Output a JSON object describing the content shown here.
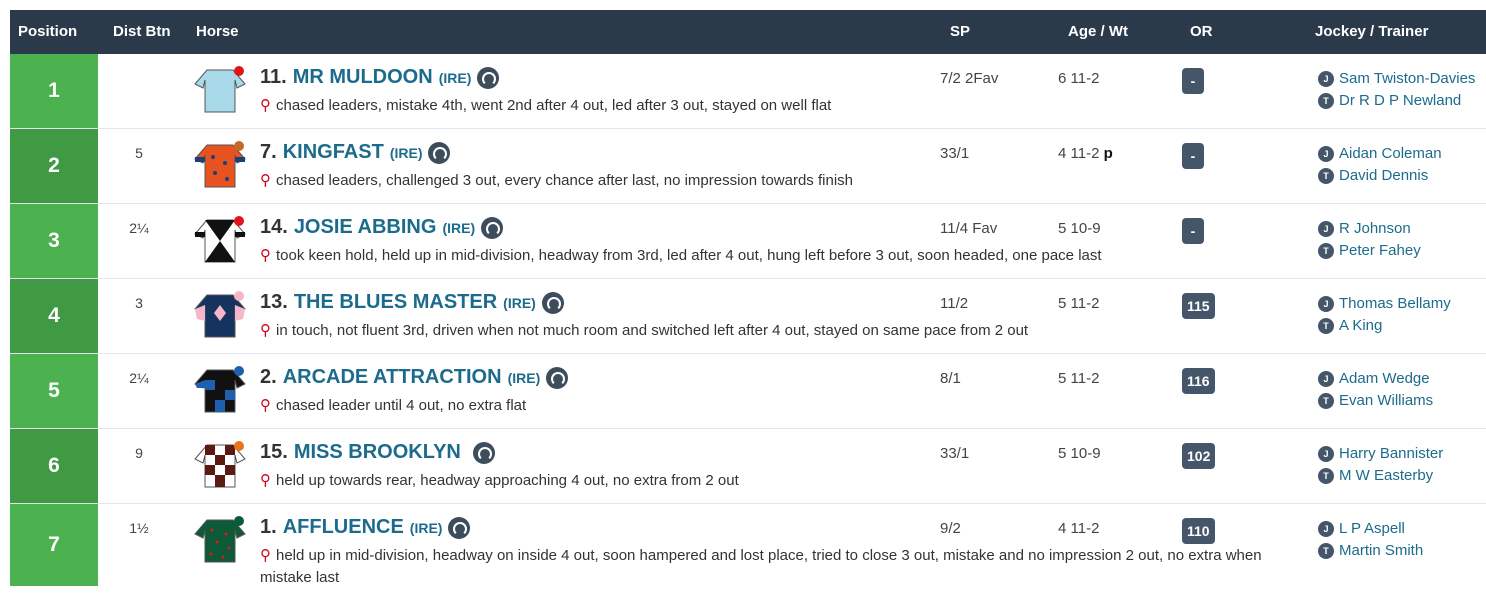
{
  "headers": {
    "position": "Position",
    "dist": "Dist Btn",
    "horse": "Horse",
    "sp": "SP",
    "agewt": "Age / Wt",
    "or": "OR",
    "jockey_trainer": "Jockey / Trainer"
  },
  "rows": [
    {
      "position": "1",
      "dist": "",
      "number": "11.",
      "name": "MR MULDOON",
      "bred": "(IRE)",
      "comment": "chased leaders, mistake 4th, went 2nd after 4 out, led after 3 out, stayed on well flat",
      "sp": "7/2 2Fav",
      "age_wt": "6 11-2",
      "headgear": "",
      "or": "-",
      "jockey": "Sam Twiston-Davies",
      "trainer": "Dr R D P Newland"
    },
    {
      "position": "2",
      "dist": "5",
      "number": "7.",
      "name": "KINGFAST",
      "bred": "(IRE)",
      "comment": "chased leaders, challenged 3 out, every chance after last, no impression towards finish",
      "sp": "33/1",
      "age_wt": "4 11-2",
      "headgear": "p",
      "or": "-",
      "jockey": "Aidan Coleman",
      "trainer": "David Dennis"
    },
    {
      "position": "3",
      "dist": "2¼",
      "number": "14.",
      "name": "JOSIE ABBING",
      "bred": "(IRE)",
      "comment": "took keen hold, held up in mid-division, headway from 3rd, led after 4 out, hung left before 3 out, soon headed, one pace last",
      "sp": "11/4 Fav",
      "age_wt": "5 10-9",
      "headgear": "",
      "or": "-",
      "jockey": "R Johnson",
      "trainer": "Peter Fahey"
    },
    {
      "position": "4",
      "dist": "3",
      "number": "13.",
      "name": "THE BLUES MASTER",
      "bred": "(IRE)",
      "comment": "in touch, not fluent 3rd, driven when not much room and switched left after 4 out, stayed on same pace from 2 out",
      "sp": "11/2",
      "age_wt": "5 11-2",
      "headgear": "",
      "or": "115",
      "jockey": "Thomas Bellamy",
      "trainer": "A King"
    },
    {
      "position": "5",
      "dist": "2¼",
      "number": "2.",
      "name": "ARCADE ATTRACTION",
      "bred": "(IRE)",
      "comment": "chased leader until 4 out, no extra flat",
      "sp": "8/1",
      "age_wt": "5 11-2",
      "headgear": "",
      "or": "116",
      "jockey": "Adam Wedge",
      "trainer": "Evan Williams"
    },
    {
      "position": "6",
      "dist": "9",
      "number": "15.",
      "name": "MISS BROOKLYN",
      "bred": "",
      "comment": "held up towards rear, headway approaching 4 out, no extra from 2 out",
      "sp": "33/1",
      "age_wt": "5 10-9",
      "headgear": "",
      "or": "102",
      "jockey": "Harry Bannister",
      "trainer": "M W Easterby"
    },
    {
      "position": "7",
      "dist": "1½",
      "number": "1.",
      "name": "AFFLUENCE",
      "bred": "(IRE)",
      "comment": "held up in mid-division, headway on inside 4 out, soon hampered and lost place, tried to close 3 out, mistake and no impression 2 out, no extra when mistake last",
      "sp": "9/2",
      "age_wt": "4 11-2",
      "headgear": "",
      "or": "110",
      "jockey": "L P Aspell",
      "trainer": "Martin Smith"
    }
  ],
  "icons": {
    "pin": "location-pin-icon",
    "horse": "horse-profile-icon",
    "jockey": "jockey-icon",
    "trainer": "trainer-icon"
  },
  "jt_labels": {
    "jockey": "J",
    "trainer": "T"
  },
  "colors": {
    "header_bg": "#2a3a4a",
    "position_bg_light": "#4cb24f",
    "position_bg_dark": "#3f9a43",
    "link": "#1c6b8c",
    "or_badge": "#46566a",
    "pin": "#d0021b"
  }
}
